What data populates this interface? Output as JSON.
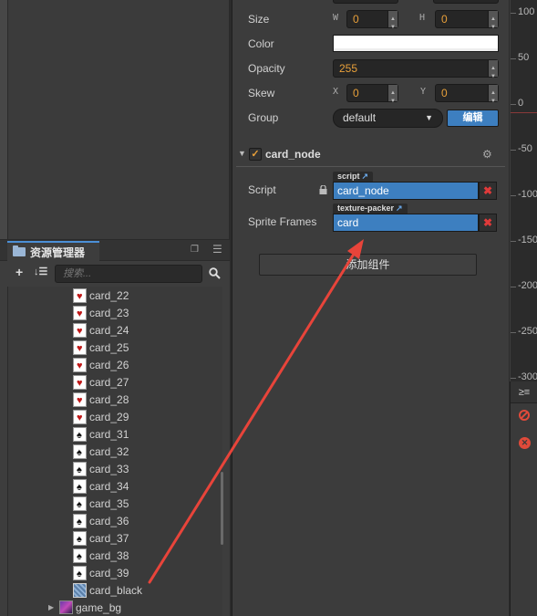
{
  "assets": {
    "tab_title": "资源管理器",
    "search_placeholder": "搜索...",
    "items": [
      {
        "label": "card_22",
        "suit": "red"
      },
      {
        "label": "card_23",
        "suit": "red"
      },
      {
        "label": "card_24",
        "suit": "red"
      },
      {
        "label": "card_25",
        "suit": "red"
      },
      {
        "label": "card_26",
        "suit": "red"
      },
      {
        "label": "card_27",
        "suit": "red"
      },
      {
        "label": "card_28",
        "suit": "red"
      },
      {
        "label": "card_29",
        "suit": "red"
      },
      {
        "label": "card_31",
        "suit": "black"
      },
      {
        "label": "card_32",
        "suit": "black"
      },
      {
        "label": "card_33",
        "suit": "black"
      },
      {
        "label": "card_34",
        "suit": "black"
      },
      {
        "label": "card_35",
        "suit": "black"
      },
      {
        "label": "card_36",
        "suit": "black"
      },
      {
        "label": "card_37",
        "suit": "black"
      },
      {
        "label": "card_38",
        "suit": "black"
      },
      {
        "label": "card_39",
        "suit": "black"
      },
      {
        "label": "card_black",
        "suit": "back"
      },
      {
        "label": "game_bg",
        "suit": "bg"
      }
    ]
  },
  "inspector": {
    "size_label": "Size",
    "size_w_axis": "W",
    "size_w": "0",
    "size_h_axis": "H",
    "size_h": "0",
    "color_label": "Color",
    "opacity_label": "Opacity",
    "opacity": "255",
    "skew_label": "Skew",
    "skew_x_axis": "X",
    "skew_x": "0",
    "skew_y_axis": "Y",
    "skew_y": "0",
    "group_label": "Group",
    "group_value": "default",
    "edit_button": "编辑",
    "component_name": "card_node",
    "script_label": "Script",
    "script_tag": "script",
    "script_value": "card_node",
    "sprite_frames_label": "Sprite Frames",
    "sprite_tag": "texture-packer",
    "sprite_value": "card",
    "add_component_button": "添加组件"
  },
  "ruler": {
    "labels": [
      "100",
      "50",
      "0",
      "-50",
      "-100",
      "-150",
      "-200",
      "-250",
      "-300"
    ]
  },
  "colors": {
    "accent_blue": "#3d7fc0",
    "annotation_red": "#e8443a",
    "value_orange": "#e8a03a"
  }
}
